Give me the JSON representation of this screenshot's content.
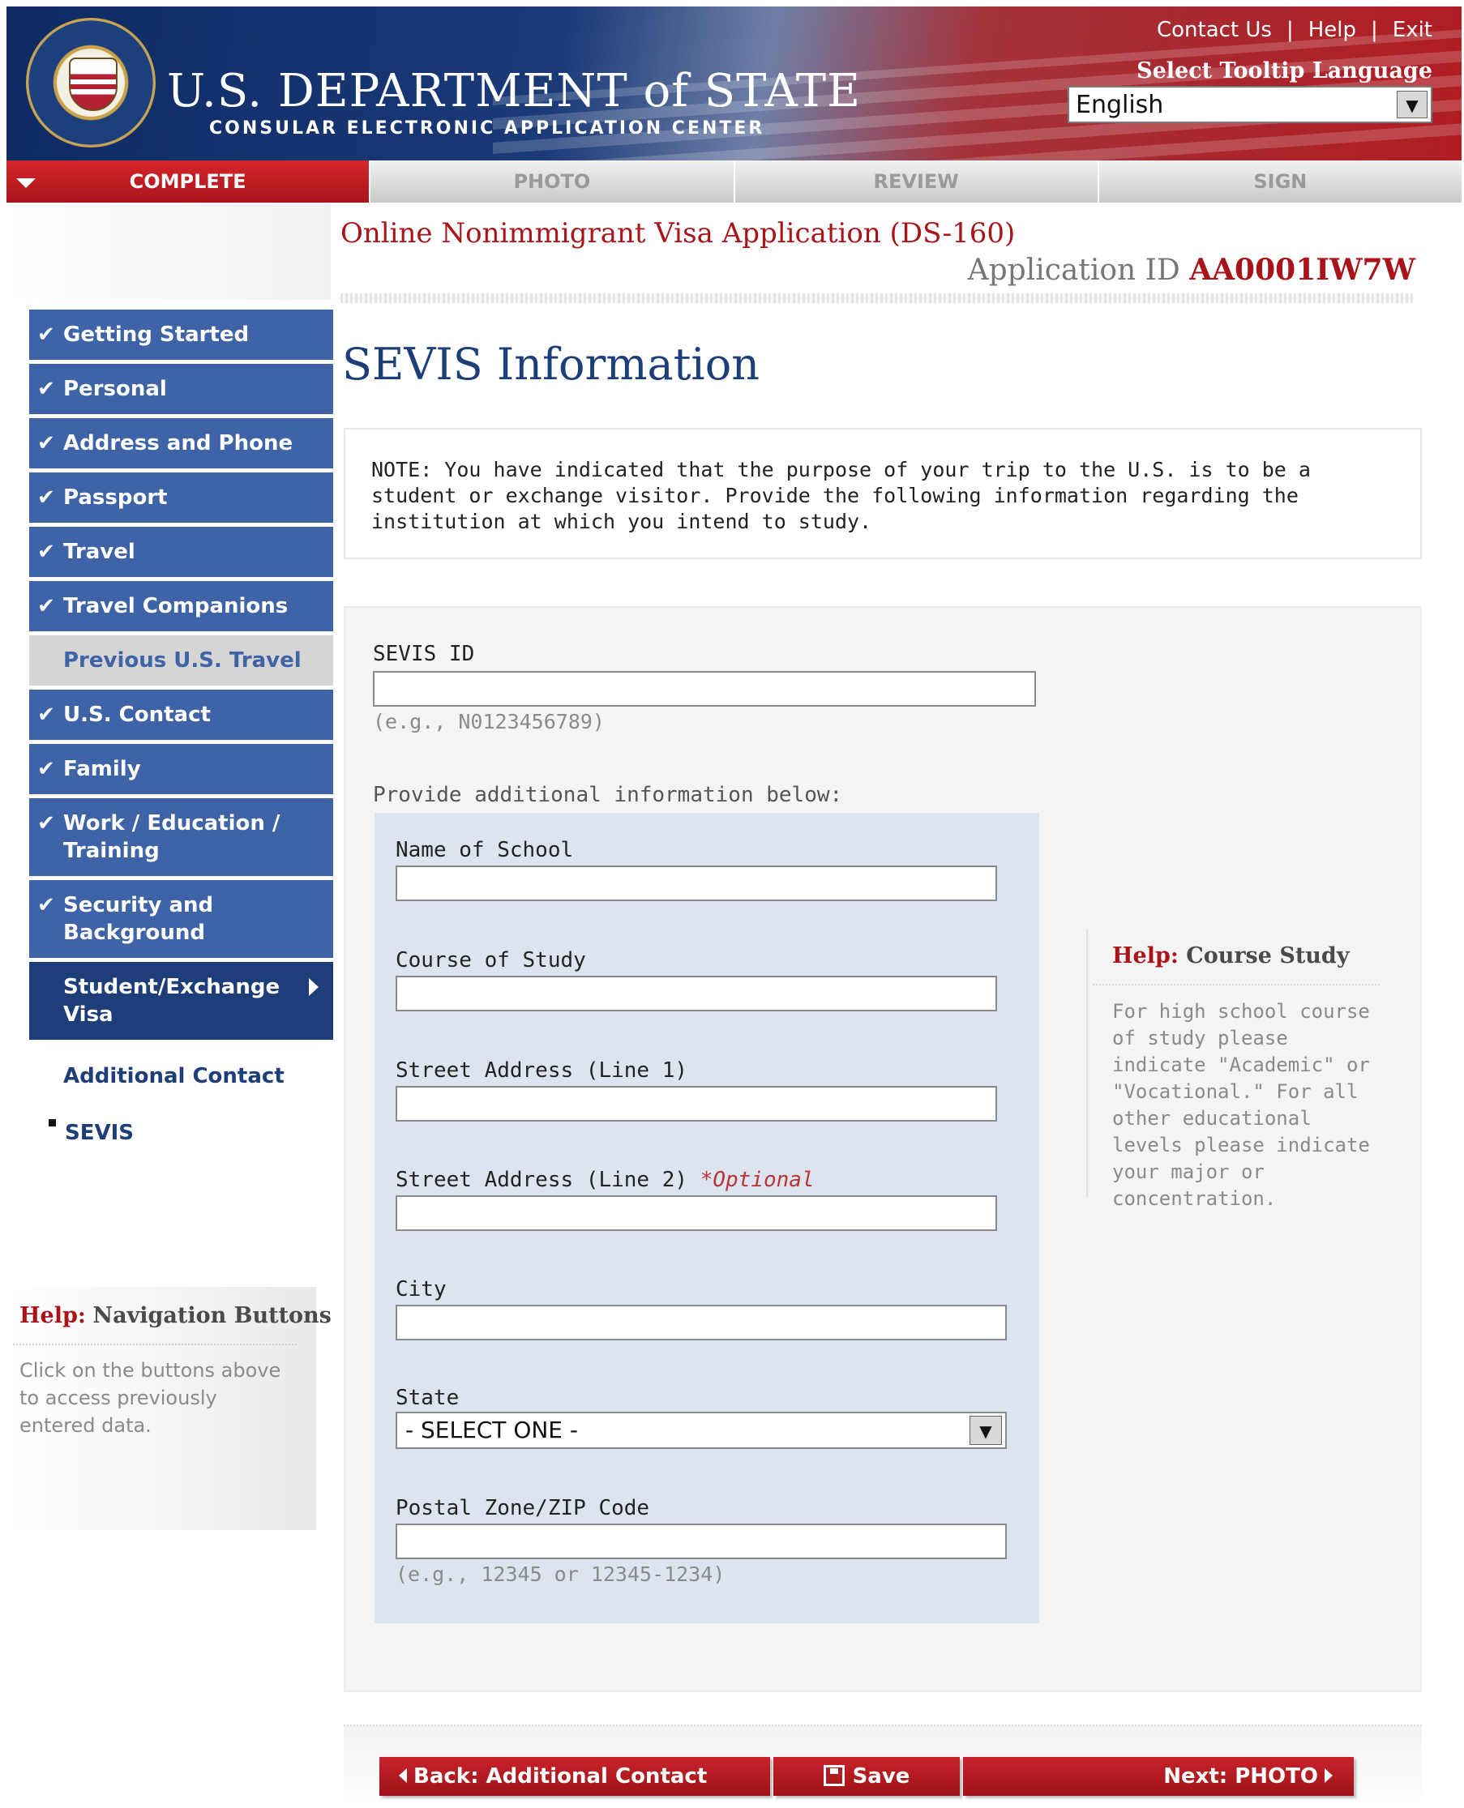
{
  "header": {
    "agency_title": "U.S. DEPARTMENT of STATE",
    "agency_subtitle": "CONSULAR ELECTRONIC APPLICATION CENTER",
    "top_links": [
      "Contact Us",
      "Help",
      "Exit"
    ],
    "tooltip_language_label": "Select Tooltip Language",
    "tooltip_language_value": "English"
  },
  "progress_tabs": [
    "COMPLETE",
    "PHOTO",
    "REVIEW",
    "SIGN"
  ],
  "form_title": "Online Nonimmigrant Visa Application (DS-160)",
  "application_id_label": "Application ID",
  "application_id": "AA0001IW7W",
  "sidebar": {
    "items": [
      {
        "label": "Getting Started",
        "state": "done"
      },
      {
        "label": "Personal",
        "state": "done"
      },
      {
        "label": "Address and Phone",
        "state": "done"
      },
      {
        "label": "Passport",
        "state": "done"
      },
      {
        "label": "Travel",
        "state": "done"
      },
      {
        "label": "Travel Companions",
        "state": "done"
      },
      {
        "label": "Previous U.S. Travel",
        "state": "disabled"
      },
      {
        "label": "U.S. Contact",
        "state": "done"
      },
      {
        "label": "Family",
        "state": "done"
      },
      {
        "label": "Work / Education / Training",
        "state": "done"
      },
      {
        "label": "Security and Background",
        "state": "done"
      },
      {
        "label": "Student/Exchange Visa",
        "state": "current"
      }
    ],
    "sub_items": [
      "Additional Contact",
      "SEVIS"
    ],
    "help_title_prefix": "Help:",
    "help_title": "Navigation Buttons",
    "help_body": "Click on the buttons above to access previously entered data."
  },
  "main": {
    "heading": "SEVIS Information",
    "note": "NOTE: You have indicated that the purpose of your trip to the U.S. is to be a student or exchange visitor. Provide the following information regarding the institution at which you intend to study.",
    "sevis_id_label": "SEVIS ID",
    "sevis_id_value": "",
    "sevis_id_hint": "(e.g., N0123456789)",
    "additional_info_label": "Provide additional information below:",
    "school_name_label": "Name of School",
    "course_label": "Course of Study",
    "street1_label": "Street Address (Line 1)",
    "street2_label": "Street Address (Line 2)",
    "optional_tag": "*Optional",
    "city_label": "City",
    "state_label": "State",
    "state_value": "- SELECT ONE -",
    "zip_label": "Postal Zone/ZIP Code",
    "zip_hint": "(e.g., 12345 or 12345-1234)"
  },
  "course_help": {
    "title_prefix": "Help:",
    "title": "Course Study",
    "body": "For high school course of study please indicate \"Academic\" or \"Vocational.\" For all other educational levels please indicate your major or concentration."
  },
  "buttons": {
    "back": "Back: Additional Contact",
    "save": "Save",
    "next": "Next: PHOTO"
  },
  "colors": {
    "nav_blue": "#3f63a7",
    "nav_current": "#1e3e79",
    "accent_red": "#a8141a"
  }
}
